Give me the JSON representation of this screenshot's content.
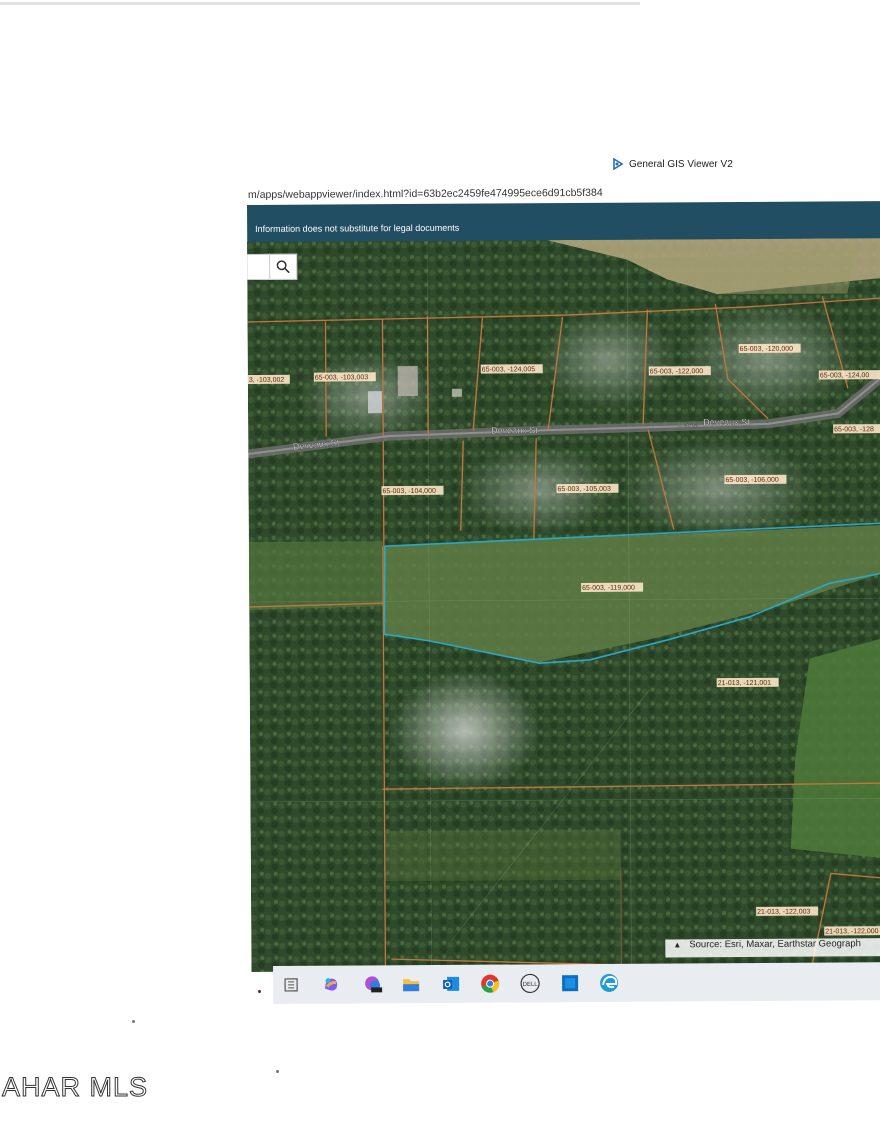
{
  "browser": {
    "tab_title": "General GIS Viewer V2",
    "url": "m/apps/webappviewer/index.html?id=63b2ec2459fe474995ece6d91cb5f384"
  },
  "app": {
    "banner_text": "Information does not substitute for legal documents",
    "search_icon": "magnifier-icon"
  },
  "map": {
    "road_labels": [
      "Deveaux St",
      "Deveaux St",
      "Deveaux St",
      "Devea"
    ],
    "parcels": [
      "3, -103,002",
      "65-003, -103,003",
      "65-003, -124,005",
      "65-003, -122,000",
      "65-003, -120,000",
      "65-003, -124,00",
      "65-003, -128",
      "65-003, -104,000",
      "65-003, -105,003",
      "65-003, -106,000",
      "65-003, -119,000",
      "21-013, -121,001",
      "21-013, -122,003",
      "21-013, -122,000"
    ],
    "attribution": "Source: Esri, Maxar, Earthstar Geograph",
    "colors": {
      "parcel_line": "#c8763f",
      "selected_parcel": "#2aa7c9",
      "label_bg": "#fde7c8"
    }
  },
  "taskbar": {
    "icons": [
      "file-explorer-icon",
      "copilot-icon",
      "microsoft-365-icon",
      "folder-icon",
      "outlook-icon",
      "chrome-icon",
      "dell-icon",
      "store-icon",
      "edge-icon"
    ]
  },
  "watermark": "AHAR MLS"
}
